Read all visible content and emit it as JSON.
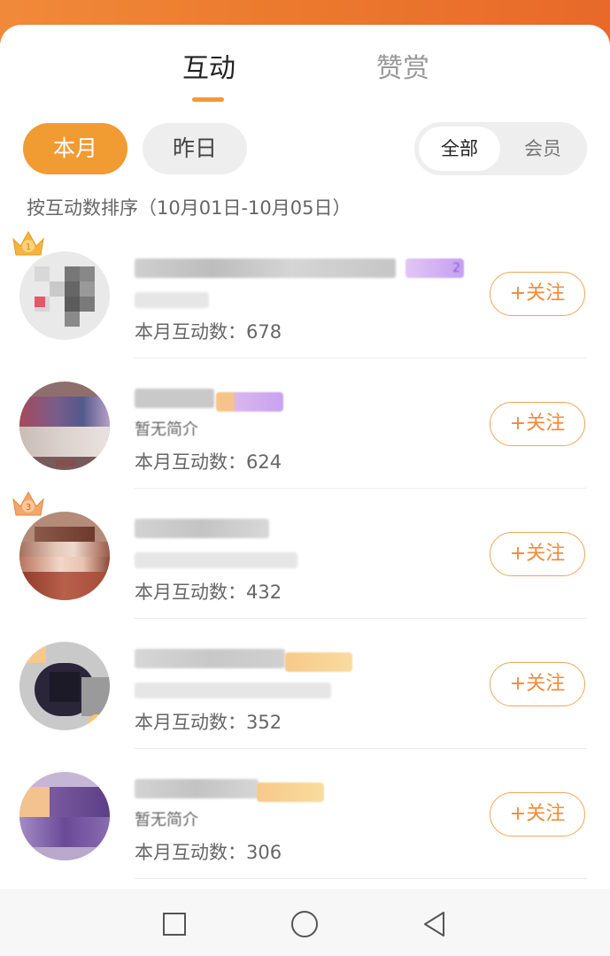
{
  "tabs": [
    {
      "label": "互动",
      "active": true
    },
    {
      "label": "赞赏",
      "active": false
    }
  ],
  "period_pills": [
    {
      "label": "本月",
      "active": true
    },
    {
      "label": "昨日",
      "active": false
    }
  ],
  "segment": [
    {
      "label": "全部",
      "active": true
    },
    {
      "label": "会员",
      "active": false
    }
  ],
  "sort_hint": "按互动数排序（10月01日-10月05日）",
  "list": [
    {
      "count_label": "本月互动数：678",
      "follow_label": "+关注",
      "badge_text": "2",
      "crown": "1"
    },
    {
      "count_label": "本月互动数：624",
      "follow_label": "+关注",
      "intro_text": "暂无简介"
    },
    {
      "count_label": "本月互动数：432",
      "follow_label": "+关注",
      "crown": "3"
    },
    {
      "count_label": "本月互动数：352",
      "follow_label": "+关注"
    },
    {
      "count_label": "本月互动数：306",
      "follow_label": "+关注",
      "intro_text": "暂无简介"
    }
  ],
  "navbar": {
    "items": [
      "square-icon",
      "circle-icon",
      "triangle-back-icon"
    ]
  },
  "colors": {
    "accent": "#f19b33",
    "follow_text": "#f08a3a",
    "band": "#ec7a2e"
  }
}
